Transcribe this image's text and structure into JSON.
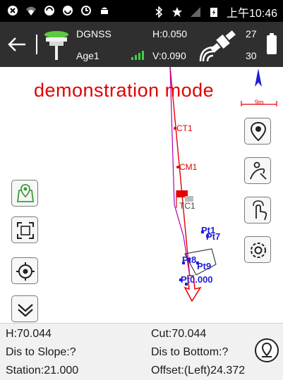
{
  "status_bar": {
    "time": "上午10:46",
    "icons": [
      "notification-icon",
      "wifi-icon",
      "sync-icon",
      "sync-icon",
      "clock-app-icon",
      "android-icon",
      "bluetooth-icon",
      "star-icon",
      "no-signal-icon",
      "battery-charging-icon"
    ]
  },
  "toolbar": {
    "solution": "DGNSS",
    "age": "Age1",
    "h_precision": "H:0.050",
    "v_precision": "V:0.090",
    "satellites_used": "27",
    "satellites_tracked": "30"
  },
  "map": {
    "mode_text": "demonstration mode",
    "scale_label": "9m",
    "stations": [
      "CT1",
      "CM1",
      "TC1"
    ],
    "points": [
      "Pt1",
      "Pt7",
      "Pt8",
      "Pt9",
      "Pt0.000"
    ],
    "colors": {
      "line": "#e30000",
      "points": "#1f1fd6",
      "trace": "#b000b0"
    }
  },
  "info": {
    "h": "H:70.044",
    "cut": "Cut:70.044",
    "dis_to_slope": "Dis to Slope:?",
    "dis_to_bottom": "Dis to Bottom:?",
    "station": "Station:21.000",
    "offset": "Offset:(Left)24.372"
  }
}
